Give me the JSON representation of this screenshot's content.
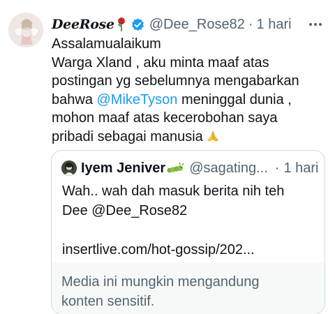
{
  "tweet": {
    "display_name": "DeeRose",
    "handle": "@Dee_Rose82",
    "separator": "·",
    "time": "1 hari",
    "body_lines": [
      "Assalamualaikum",
      "Warga Xland , aku minta maaf atas",
      "postingan yg sebelumnya mengabarkan"
    ],
    "line4_before": "bahwa ",
    "line4_mention": "@MikeTyson",
    "line4_after": " meninggal dunia ,",
    "body_lines_end": [
      "mohon maaf atas kecerobohan saya",
      "pribadi sebagai manusia"
    ],
    "icons": {
      "name_emoji": "rose-icon",
      "verified": "verified-badge-icon",
      "end_emoji": "folded-hands-icon",
      "more": "more-options-icon"
    }
  },
  "quote": {
    "display_name": "Iyem Jeniver",
    "handle": "@sagating...",
    "separator": "·",
    "time": "1 hari",
    "lines": [
      "Wah.. wah dah masuk berita nih teh",
      "Dee @Dee_Rose82",
      "",
      "insertlive.com/hot-gossip/202..."
    ],
    "sensitive_lines": [
      "Media ini mungkin mengandung",
      "konten sensitif."
    ],
    "icons": {
      "name_emoji": "caterpillar-icon"
    }
  },
  "colors": {
    "accent": "#1d9bf0",
    "secondary_text": "#536471",
    "border": "#cfd9de",
    "sensitive_bg": "#f7f9f9"
  }
}
